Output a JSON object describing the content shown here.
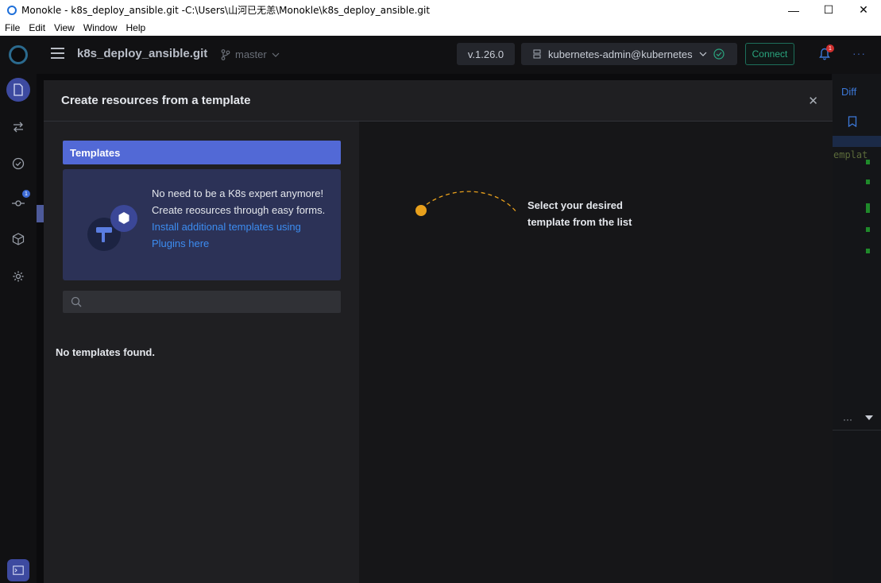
{
  "window": {
    "title": "Monokle - k8s_deploy_ansible.git -C:\\Users\\山河已无恙\\Monokle\\k8s_deploy_ansible.git",
    "controls": {
      "minimize": "—",
      "maximize": "☐",
      "close": "✕"
    }
  },
  "menubar": {
    "items": [
      "File",
      "Edit",
      "View",
      "Window",
      "Help"
    ]
  },
  "header": {
    "project_name": "k8s_deploy_ansible.git",
    "branch": "master",
    "version": "v.1.26.0",
    "cluster": "kubernetes-admin@kubernetes",
    "connect_label": "Connect",
    "notification_count": "1",
    "more": "···"
  },
  "rail": {
    "badge_count": "1"
  },
  "background": {
    "diff_label": "Diff",
    "code_fragment": "emplat",
    "more": "···"
  },
  "modal": {
    "title": "Create resources from a template",
    "close": "✕",
    "tab_label": "Templates",
    "promo_text": "No need to be a K8s expert anymore! Create reosurces through easy forms. ",
    "promo_link": "Install additional templates using Plugins here",
    "search_placeholder": "",
    "empty_text": "No templates found.",
    "hint_text": "Select your desired template from the list"
  },
  "colors": {
    "accent": "#5269d6",
    "link": "#3c8cf0",
    "connect": "#2aa67f",
    "hint_dot": "#e8a01c"
  }
}
